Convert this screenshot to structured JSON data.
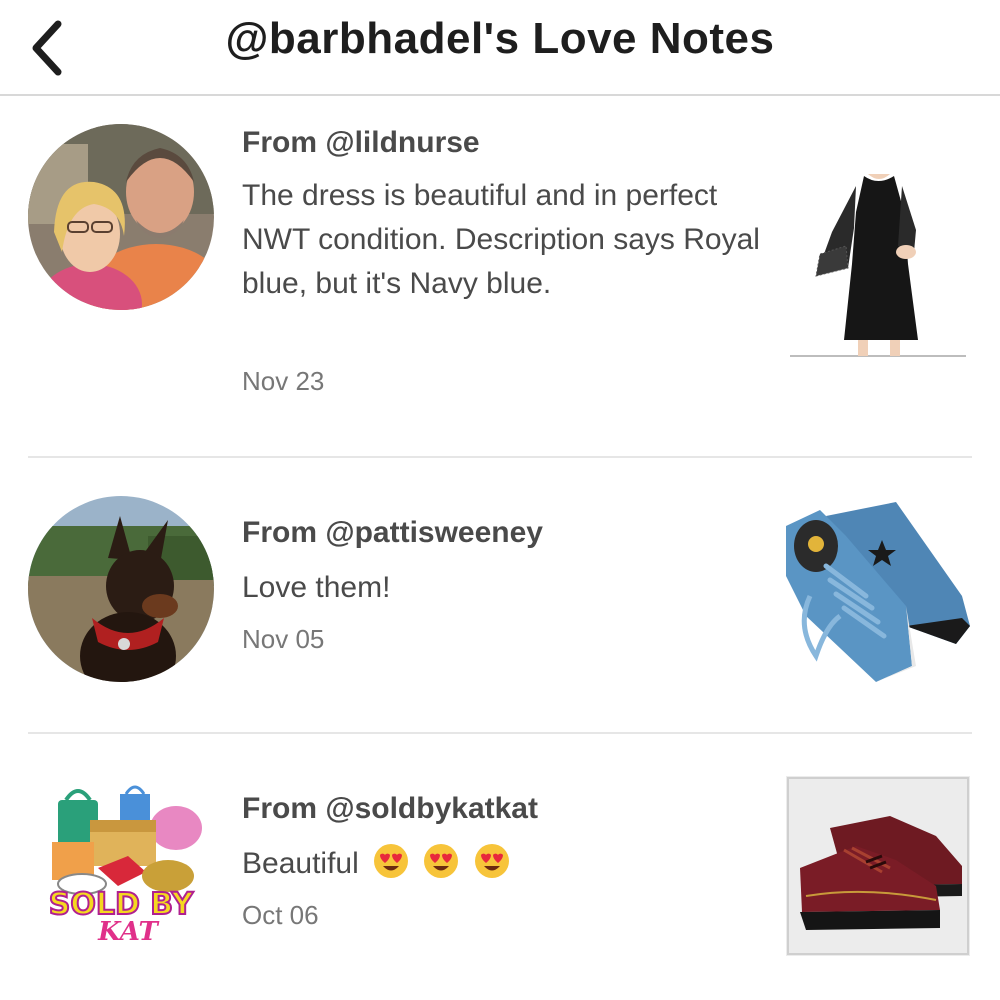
{
  "header": {
    "title": "@barbhadel's Love Notes",
    "back_icon": "chevron-left-icon"
  },
  "notes": [
    {
      "from": "From @lildnurse",
      "message": "The dress is beautiful and in perfect NWT condition. Description says Royal blue, but it's Navy blue.",
      "date": "Nov 23",
      "avatar": "couple-photo-avatar",
      "item_image": "black-lace-sleeve-dress"
    },
    {
      "from": "From @pattisweeney",
      "message": "Love them!",
      "date": "Nov 05",
      "avatar": "doberman-dog-avatar",
      "item_image": "blue-converse-sneakers"
    },
    {
      "from": "From @soldbykatkat",
      "message": "Beautiful",
      "message_emoji": [
        "heart-eyes-emoji",
        "heart-eyes-emoji",
        "heart-eyes-emoji"
      ],
      "date": "Oct 06",
      "avatar": "sold-by-kat-logo-avatar",
      "avatar_logo_text": "SOLD BY KAT",
      "item_image": "burgundy-velvet-vans"
    }
  ],
  "colors": {
    "title": "#1e1e1e",
    "body_text": "#4a4a4a",
    "date_text": "#777777",
    "divider": "#e6e6e6"
  }
}
